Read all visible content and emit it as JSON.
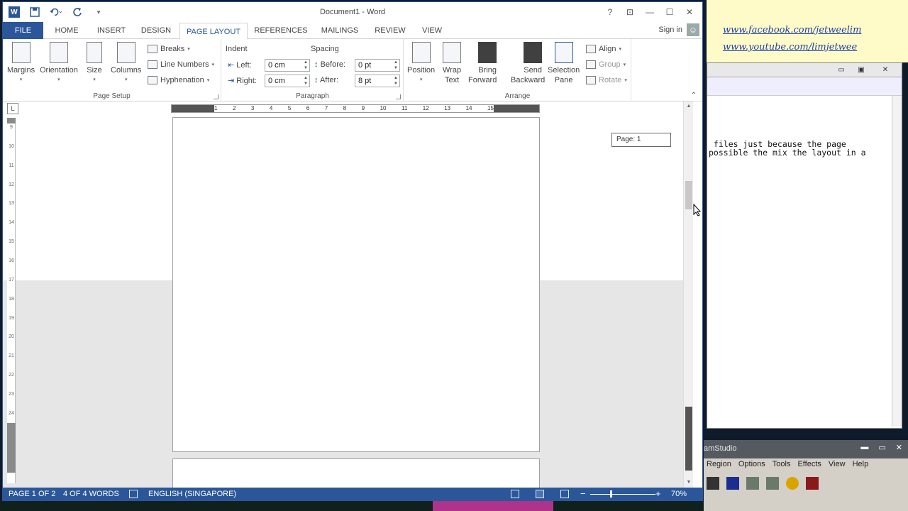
{
  "word": {
    "title": "Document1 - Word",
    "qat": {
      "logo": "W",
      "save_icon": "save-icon",
      "undo_icon": "undo-icon",
      "redo_icon": "repeat-icon",
      "customize_icon": "customize-qat-icon"
    },
    "window_controls": {
      "help": "?",
      "restore_ribbon": "⊡",
      "minimize": "—",
      "maximize": "☐",
      "close": "✕"
    },
    "tabs": [
      {
        "label": "FILE"
      },
      {
        "label": "HOME"
      },
      {
        "label": "INSERT"
      },
      {
        "label": "DESIGN"
      },
      {
        "label": "PAGE LAYOUT"
      },
      {
        "label": "REFERENCES"
      },
      {
        "label": "MAILINGS"
      },
      {
        "label": "REVIEW"
      },
      {
        "label": "VIEW"
      }
    ],
    "active_tab": "PAGE LAYOUT",
    "sign_in": "Sign in",
    "ribbon": {
      "page_setup": {
        "label": "Page Setup",
        "margins": "Margins",
        "orientation": "Orientation",
        "size": "Size",
        "columns": "Columns",
        "breaks": "Breaks",
        "line_numbers": "Line Numbers",
        "hyphenation": "Hyphenation"
      },
      "paragraph": {
        "label": "Paragraph",
        "indent": "Indent",
        "spacing": "Spacing",
        "left_label": "Left:",
        "right_label": "Right:",
        "before_label": "Before:",
        "after_label": "After:",
        "left_value": "0 cm",
        "right_value": "0 cm",
        "before_value": "0 pt",
        "after_value": "8 pt"
      },
      "arrange": {
        "label": "Arrange",
        "position": "Position",
        "wrap_text_1": "Wrap",
        "wrap_text_2": "Text",
        "bring_forward_1": "Bring",
        "bring_forward_2": "Forward",
        "send_backward_1": "Send",
        "send_backward_2": "Backward",
        "selection_pane_1": "Selection",
        "selection_pane_2": "Pane",
        "align": "Align",
        "group": "Group",
        "rotate": "Rotate"
      }
    },
    "ruler_ticks": [
      "1",
      "2",
      "3",
      "4",
      "5",
      "6",
      "7",
      "8",
      "9",
      "10",
      "11",
      "12",
      "13",
      "14",
      "15"
    ],
    "vruler_ticks": [
      "9",
      "10",
      "11",
      "12",
      "13",
      "14",
      "15",
      "16",
      "17",
      "18",
      "19",
      "20",
      "21",
      "22",
      "23",
      "24"
    ],
    "page_tooltip": "Page: 1",
    "status": {
      "page": "PAGE 1 OF 2",
      "words": "4 OF 4 WORDS",
      "language": "ENGLISH (SINGAPORE)",
      "zoom": "70%",
      "zoom_level": 0.7
    }
  },
  "note": {
    "facebook": "www.facebook.com/jetweelim",
    "youtube": "www.youtube.com/limjetwee"
  },
  "editor": {
    "line1": " files just because the page",
    "line2": "possible the mix the layout in a"
  },
  "camstudio": {
    "title": "amStudio",
    "menu": [
      "Region",
      "Options",
      "Tools",
      "Effects",
      "View",
      "Help"
    ]
  },
  "colors": {
    "word_blue": "#2b579a",
    "note_yellow": "#fffbc8",
    "link_blue": "#1f3fa8"
  }
}
